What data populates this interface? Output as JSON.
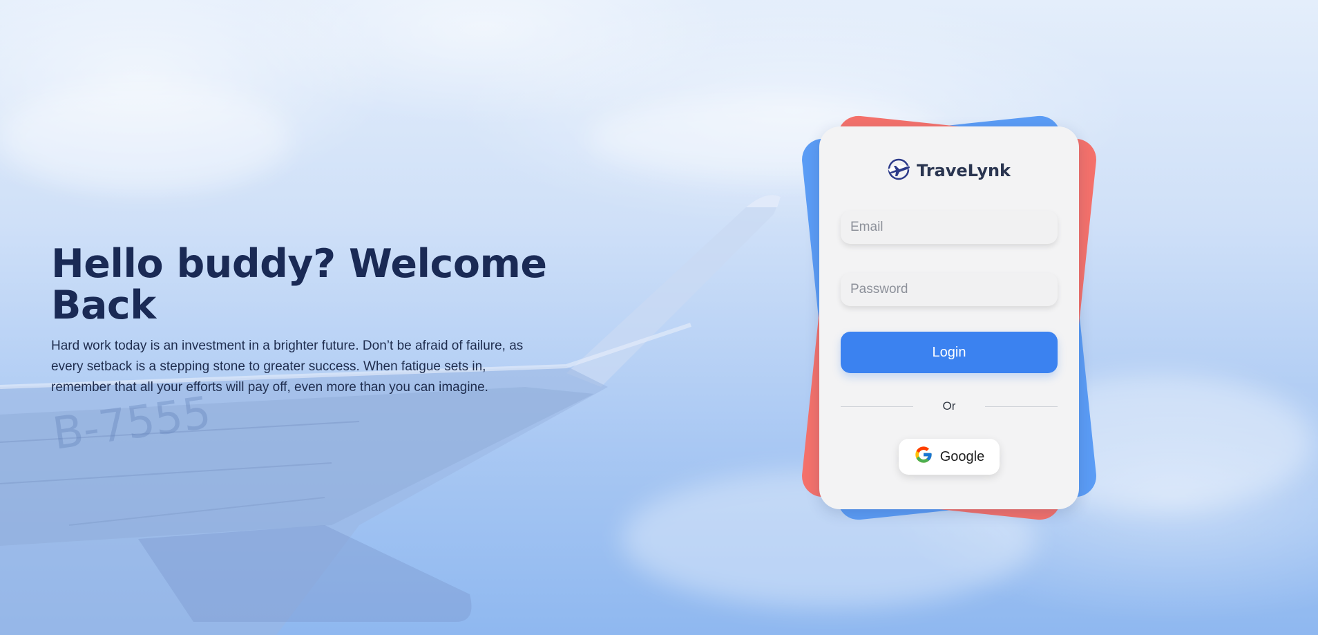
{
  "hero": {
    "title": "Hello buddy? Welcome Back",
    "description": "Hard work today is an investment in a brighter future. Don’t be afraid of failure, as every setback is a stepping stone to greater success. When fatigue sets in, remember that all your efforts will pay off, even more than you can imagine."
  },
  "login_card": {
    "brand": {
      "name": "TraveLynk",
      "icon": "airplane-globe-icon"
    },
    "email": {
      "placeholder": "Email",
      "value": ""
    },
    "password": {
      "placeholder": "Password",
      "value": ""
    },
    "login_label": "Login",
    "divider_label": "Or",
    "google": {
      "label": "Google",
      "icon": "google-icon"
    }
  },
  "colors": {
    "primary_blue": "#3b82f0",
    "back_card_blue": "#5b9cf5",
    "back_card_red": "#f4716b",
    "heading": "#1a2a55",
    "card_bg": "#f3f3f4"
  },
  "background": {
    "scene": "airplane-wing-above-clouds"
  }
}
